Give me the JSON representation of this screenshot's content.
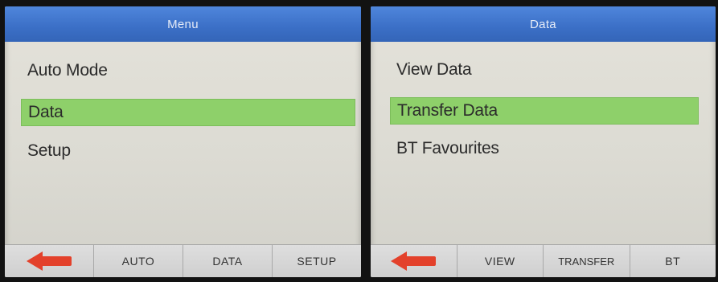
{
  "left_screen": {
    "title": "Menu",
    "items": [
      {
        "label": "Auto Mode",
        "selected": false
      },
      {
        "label": "Data",
        "selected": true
      },
      {
        "label": "Setup",
        "selected": false
      }
    ],
    "softkeys": {
      "back_icon": "left-arrow-icon",
      "key1": "AUTO",
      "key2": "DATA",
      "key3": "SETUP"
    }
  },
  "right_screen": {
    "title": "Data",
    "items": [
      {
        "label": "View Data",
        "selected": false
      },
      {
        "label": "Transfer Data",
        "selected": true
      },
      {
        "label": "BT Favourites",
        "selected": false
      }
    ],
    "softkeys": {
      "back_icon": "left-arrow-icon",
      "key1": "VIEW",
      "key2": "TRANSFER",
      "key3": "BT"
    }
  },
  "colors": {
    "title_bar": "#3b6fc6",
    "selection": "#8ed06a",
    "back_arrow": "#e3412b",
    "screen_bg": "#dcdbd3"
  }
}
